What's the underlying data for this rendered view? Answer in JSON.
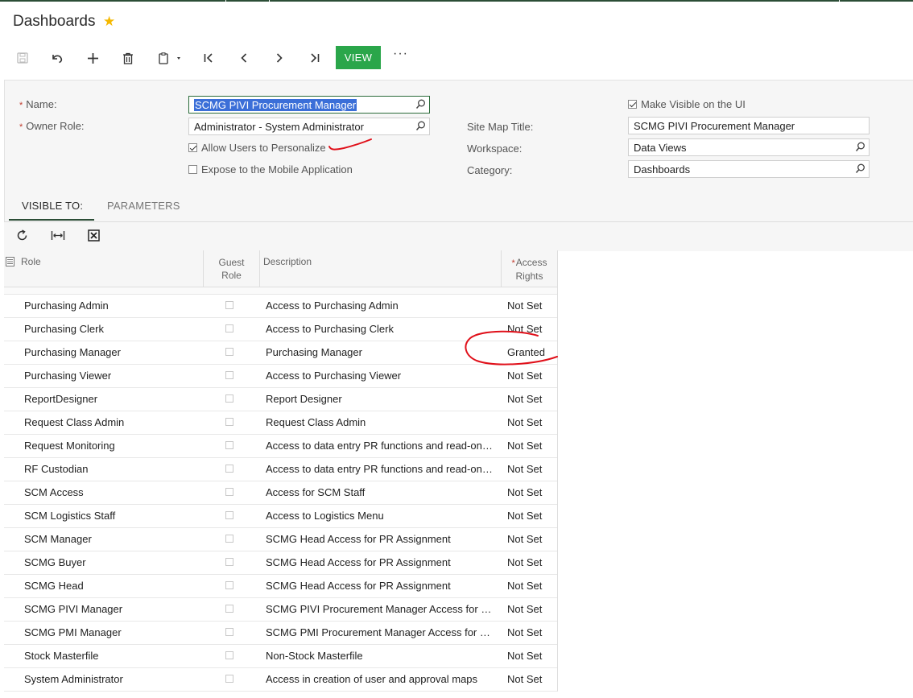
{
  "page": {
    "title": "Dashboards"
  },
  "toolbar": {
    "view_label": "VIEW",
    "more_label": "···"
  },
  "form": {
    "name_label": "Name:",
    "name_value": "SCMG PIVI Procurement Manager",
    "owner_role_label": "Owner Role:",
    "owner_role_value": "Administrator - System Administrator",
    "allow_personalize_label": "Allow Users to Personalize",
    "allow_personalize_checked": true,
    "expose_mobile_label": "Expose to the Mobile Application",
    "expose_mobile_checked": false,
    "make_visible_label": "Make Visible on the UI",
    "make_visible_checked": true,
    "site_map_title_label": "Site Map Title:",
    "site_map_title_value": "SCMG PIVI Procurement Manager",
    "workspace_label": "Workspace:",
    "workspace_value": "Data Views",
    "category_label": "Category:",
    "category_value": "Dashboards"
  },
  "tabs": [
    {
      "label": "VISIBLE TO:",
      "active": true
    },
    {
      "label": "PARAMETERS",
      "active": false
    }
  ],
  "grid": {
    "columns": {
      "role": "Role",
      "guest_role_1": "Guest",
      "guest_role_2": "Role",
      "description": "Description",
      "access_rights_1": "Access",
      "access_rights_2": "Rights"
    },
    "rows": [
      {
        "role": "Purchasing Admin",
        "description": "Access to Purchasing Admin",
        "access": "Not Set"
      },
      {
        "role": "Purchasing Clerk",
        "description": "Access to Purchasing Clerk",
        "access": "Not Set"
      },
      {
        "role": "Purchasing Manager",
        "description": "Purchasing Manager",
        "access": "Granted"
      },
      {
        "role": "Purchasing Viewer",
        "description": "Access to Purchasing Viewer",
        "access": "Not Set"
      },
      {
        "role": "ReportDesigner",
        "description": "Report Designer",
        "access": "Not Set"
      },
      {
        "role": "Request Class Admin",
        "description": "Request Class Admin",
        "access": "Not Set"
      },
      {
        "role": "Request Monitoring",
        "description": "Access to data entry PR functions and read-on…",
        "access": "Not Set"
      },
      {
        "role": "RF Custodian",
        "description": "Access to data entry PR functions and read-on…",
        "access": "Not Set"
      },
      {
        "role": "SCM Access",
        "description": "Access for SCM Staff",
        "access": "Not Set"
      },
      {
        "role": "SCM Logistics Staff",
        "description": "Access to Logistics Menu",
        "access": "Not Set"
      },
      {
        "role": "SCM Manager",
        "description": "SCMG Head Access for PR Assignment",
        "access": "Not Set"
      },
      {
        "role": "SCMG Buyer",
        "description": "SCMG Head Access for PR Assignment",
        "access": "Not Set"
      },
      {
        "role": "SCMG Head",
        "description": "SCMG Head Access for PR Assignment",
        "access": "Not Set"
      },
      {
        "role": "SCMG PIVI Manager",
        "description": "SCMG PIVI Procurement Manager Access for …",
        "access": "Not Set"
      },
      {
        "role": "SCMG PMI Manager",
        "description": "SCMG PMI Procurement Manager Access for …",
        "access": "Not Set"
      },
      {
        "role": "Stock Masterfile",
        "description": "Non-Stock Masterfile",
        "access": "Not Set"
      },
      {
        "role": "System Administrator",
        "description": "Access in creation of user and approval maps",
        "access": "Not Set"
      }
    ]
  },
  "colors": {
    "accent": "#2aa64a",
    "dark_accent": "#2b4d36",
    "star": "#f5b800",
    "annotation": "#e0101a"
  }
}
